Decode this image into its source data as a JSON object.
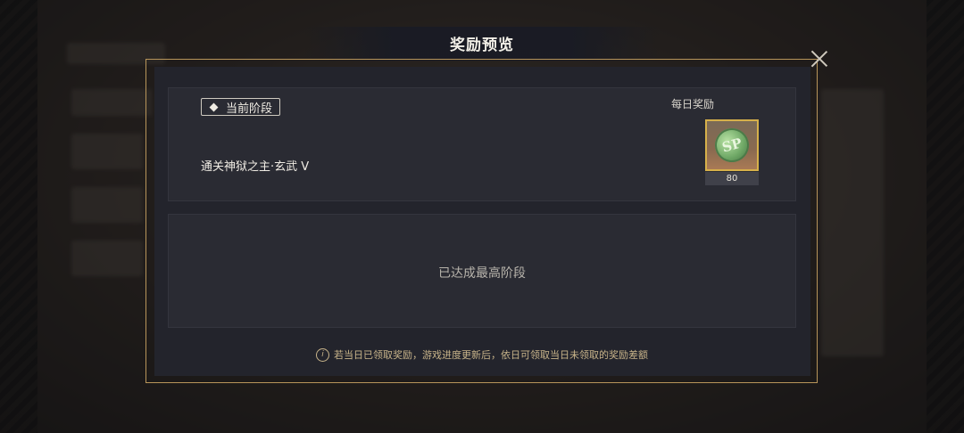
{
  "dialog": {
    "title": "奖励预览",
    "close_icon": "close-icon"
  },
  "current_stage": {
    "tag_label": "当前阶段",
    "stage_name": "通关神狱之主·玄武 V",
    "daily_reward_label": "每日奖励",
    "reward": {
      "icon": "sp-coin-icon",
      "icon_text": "SP",
      "quantity": "80"
    }
  },
  "next_stage": {
    "message": "已达成最高阶段"
  },
  "footer": {
    "note": "若当日已领取奖励，游戏进度更新后，依日可领取当日未领取的奖励差额",
    "note_icon": "info-icon"
  }
}
